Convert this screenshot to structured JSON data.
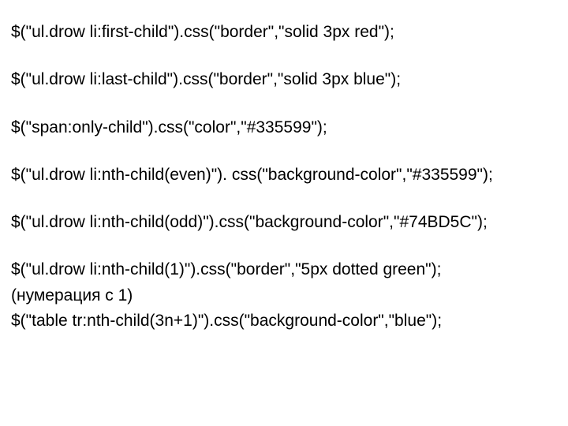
{
  "lines": {
    "l1": "$(\"ul.drow li:first-child\").css(\"border\",\"solid 3px red\");",
    "l2": "$(\"ul.drow li:last-child\").css(\"border\",\"solid 3px blue\");",
    "l3": "$(\"span:only-child\").css(\"color\",\"#335599\");",
    "l4": "$(\"ul.drow li:nth-child(even)\"). css(\"background-color\",\"#335599\");",
    "l5": "$(\"ul.drow li:nth-child(odd)\").css(\"background-color\",\"#74BD5C\");",
    "l6": "$(\"ul.drow li:nth-child(1)\").css(\"border\",\"5px dotted green\");",
    "note": "(нумерация с 1)",
    "l7": "$(\"table tr:nth-child(3n+1)\").css(\"background-color\",\"blue\");"
  }
}
